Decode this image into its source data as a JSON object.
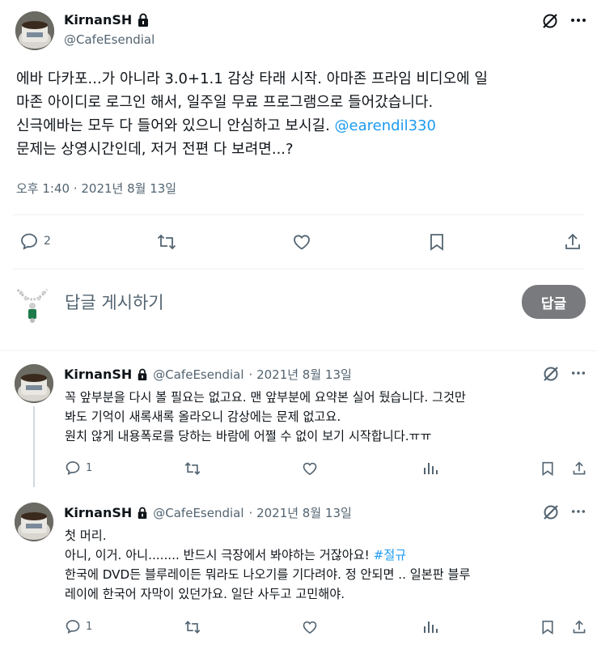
{
  "main_tweet": {
    "display_name": "KirnanSH",
    "handle": "@CafeEsendial",
    "lines": [
      "에바 다카포...가 아니라 3.0+1.1 감상 타래 시작. 아마존 프라임 비디오에 일",
      "마존 아이디로 로그인 해서, 일주일 무료 프로그램으로 들어갔습니다.",
      "신극에바는 모두 다 들어와 있으니 안심하고 보시길.",
      "문제는 상영시간인데, 저거 전편 다 보려면...?"
    ],
    "mention": "@earendil330",
    "timestamp": "오후 1:40 · 2021년 8월 13일",
    "reply_count": "2"
  },
  "composer": {
    "placeholder": "답글 게시하기",
    "button_label": "답글"
  },
  "replies": [
    {
      "display_name": "KirnanSH",
      "handle": "@CafeEsendial",
      "date": "· 2021년 8월 13일",
      "lines": [
        "꼭 앞부분을 다시 볼 필요는 없고요. 맨 앞부분에 요약본 실어 뒀습니다. 그것만",
        "봐도 기억이 새록새록 올라오니 감상에는 문제 없고요.",
        "원치 않게 내용폭로를 당하는 바람에 어쩔 수 없이 보기 시작합니다.ㅠㅠ"
      ],
      "reply_count": "1"
    },
    {
      "display_name": "KirnanSH",
      "handle": "@CafeEsendial",
      "date": "· 2021년 8월 13일",
      "line1": "첫 머리.",
      "line2_prefix": "아니, 이거. 아니........ 반드시 극장에서 봐야하는 거잖아요! ",
      "hashtag": "#절규",
      "line3": "한국에 DVD든 블루레이든 뭐라도 나오기를 기다려야. 정 안되면 .. 일본판 블루",
      "line4": "레이에 한국어 자막이 있던가요. 일단 사두고 고민해야.",
      "reply_count": "1"
    }
  ],
  "colors": {
    "link": "#1d9bf0",
    "muted": "#536471",
    "reply_button": "#787a7d"
  }
}
